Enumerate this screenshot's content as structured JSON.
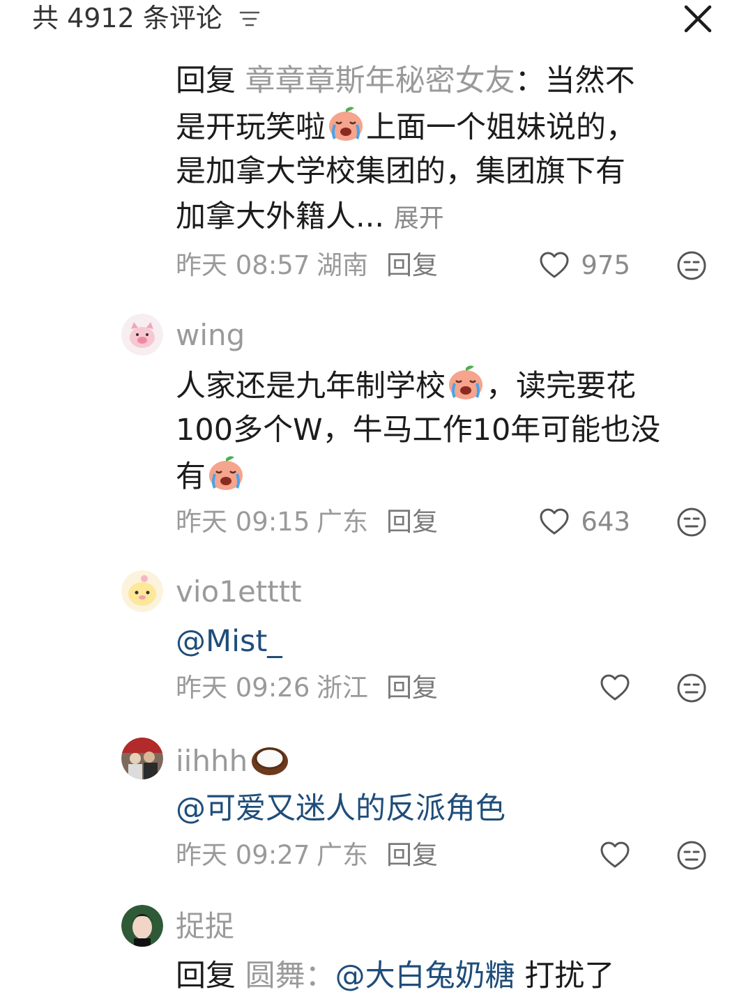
{
  "header": {
    "title": "共 4912 条评论"
  },
  "comments": [
    {
      "reply_prefix": "回复",
      "reply_target": "章章章斯年秘密女友",
      "lines": [
        "：当然不",
        "上面一个姐妹说的，",
        "是加拿大学校集团的，集团旗下有",
        "加拿大外籍人..."
      ],
      "line2_prefix": "是开玩笑啦",
      "expand": "展开",
      "time": "昨天 08:57",
      "location": "湖南",
      "reply_label": "回复",
      "likes": "975"
    },
    {
      "username": "wing",
      "lines": [
        "人家还是九年制学校",
        "，读完要花",
        "100多个W，牛马工作10年可能也没",
        "有"
      ],
      "time": "昨天 09:15",
      "location": "广东",
      "reply_label": "回复",
      "likes": "643"
    },
    {
      "username": "vio1etttt",
      "mention": "@Mist_",
      "time": "昨天 09:26",
      "location": "浙江",
      "reply_label": "回复"
    },
    {
      "username": "iihhh",
      "mention": "@可爱又迷人的反派角色",
      "time": "昨天 09:27",
      "location": "广东",
      "reply_label": "回复"
    },
    {
      "username": "捉捉",
      "partial_prefix": "回复",
      "partial_target": "圆舞：",
      "partial_mention": "@大白兔奶糖",
      "partial_tail": "打扰了"
    }
  ],
  "icons": {
    "sort": "sort-filter-icon",
    "close": "close-icon",
    "like": "heart-outline-icon",
    "dislike": "meh-face-icon",
    "crying_emoji": "crying-peach-emoji",
    "coconut": "coconut-emoji"
  },
  "colors": {
    "text": "#1c1c1c",
    "secondary": "#9a9a9a",
    "mention": "#1f4d7a"
  }
}
